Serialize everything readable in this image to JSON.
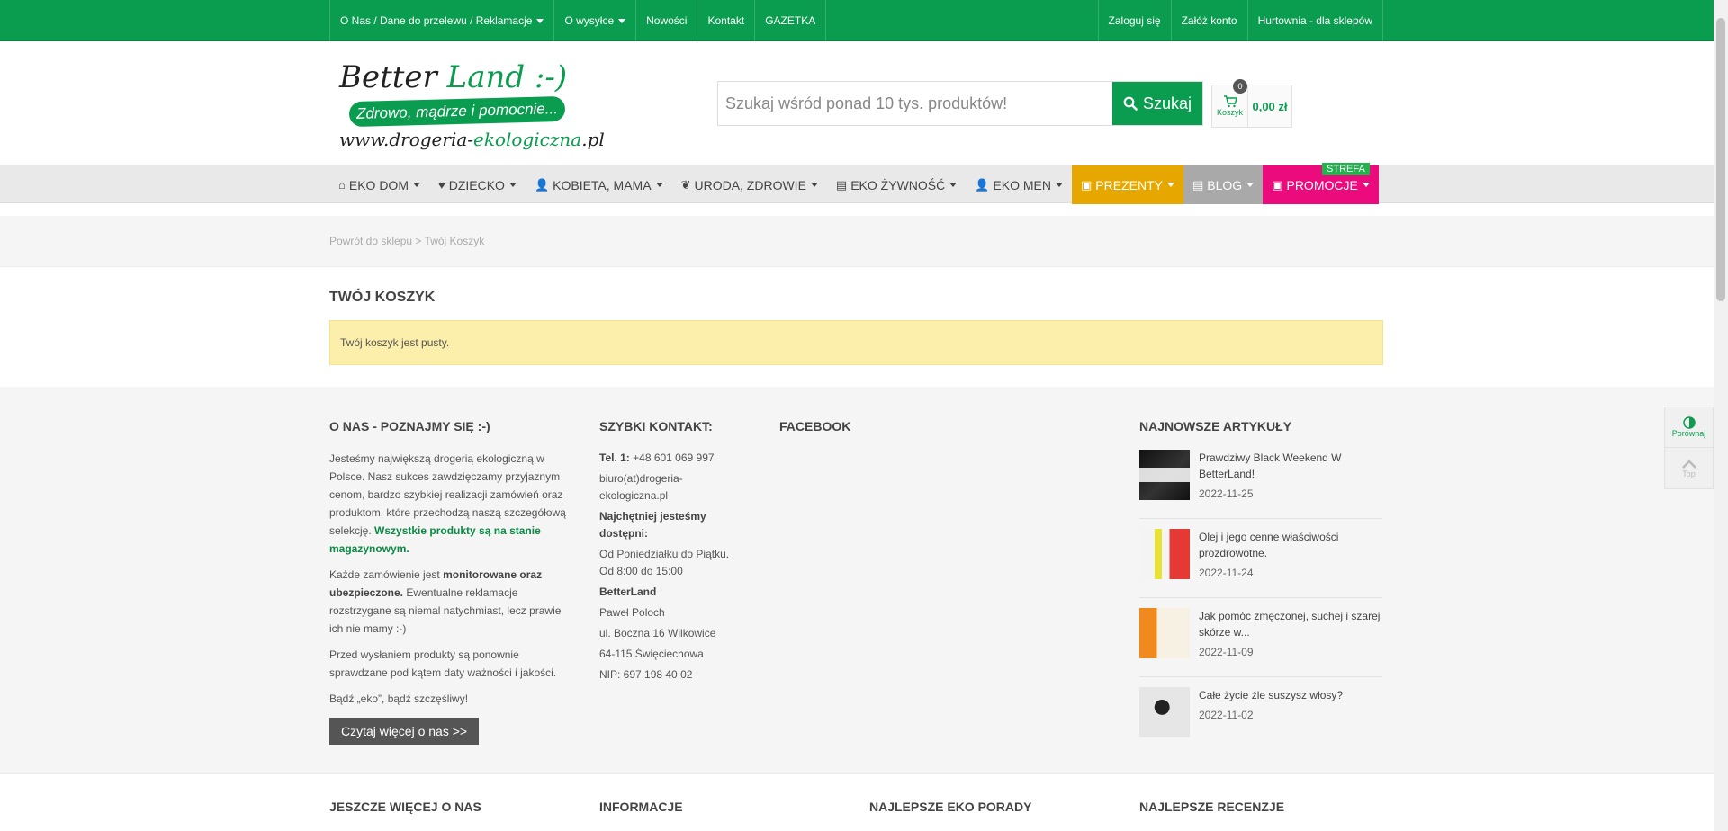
{
  "topbar": {
    "left": [
      {
        "label": "O Nas / Dane do przelewu / Reklamacje",
        "caret": true
      },
      {
        "label": "O wysyłce",
        "caret": true
      },
      {
        "label": "Nowości",
        "caret": false
      },
      {
        "label": "Kontakt",
        "caret": false
      },
      {
        "label": "GAZETKA",
        "caret": false
      }
    ],
    "right": [
      "Zaloguj się",
      "Załóż konto",
      "Hurtownia - dla sklepów"
    ]
  },
  "logo": {
    "line1_a": "Better ",
    "line1_b": "Land :-)",
    "slogan": "Zdrowo, mądrze i pomocnie...",
    "url_a": "www.drogeria-",
    "url_b": "ekologiczna",
    "url_c": ".pl"
  },
  "search": {
    "placeholder": "Szukaj wśród ponad 10 tys. produktów!",
    "button": "Szukaj"
  },
  "cart": {
    "count": "0",
    "label": "Koszyk",
    "total": "0,00 zł"
  },
  "nav": [
    {
      "label": "EKO DOM",
      "icon": "home-icon",
      "glyph": "⌂",
      "style": ""
    },
    {
      "label": "DZIECKO",
      "icon": "heart-icon",
      "glyph": "♥",
      "style": ""
    },
    {
      "label": "KOBIETA, MAMA",
      "icon": "user-icon",
      "glyph": "👤",
      "style": ""
    },
    {
      "label": "URODA, ZDROWIE",
      "icon": "leaf-icon",
      "glyph": "❦",
      "style": ""
    },
    {
      "label": "EKO ŻYWNOŚĆ",
      "icon": "shop-icon",
      "glyph": "▤",
      "style": ""
    },
    {
      "label": "EKO MEN",
      "icon": "man-icon",
      "glyph": "👤",
      "style": ""
    },
    {
      "label": "PREZENTY",
      "icon": "gift-icon",
      "glyph": "▣",
      "style": "gold"
    },
    {
      "label": "BLOG",
      "icon": "document-icon",
      "glyph": "▤",
      "style": "gray"
    },
    {
      "label": "PROMOCJE",
      "icon": "gift-icon",
      "glyph": "▣",
      "style": "pink",
      "badge": "STREFA"
    }
  ],
  "breadcrumb": {
    "back": "Powrót do sklepu",
    "sep": ">",
    "current": "Twój Koszyk"
  },
  "main": {
    "title": "TWÓJ KOSZYK",
    "alert": "Twój koszyk jest pusty."
  },
  "footer": {
    "about": {
      "heading": "O NAS - POZNAJMY SIĘ :-)",
      "p1": "Jesteśmy największą drogerią ekologiczną w Polsce. Nasz sukces zawdzięczamy przyjaznym cenom, bardzo szybkiej realizacji zamówień oraz produktom, które przechodzą naszą szczegółową selekcję. ",
      "p1_green": "Wszystkie produkty są na stanie magazynowym.",
      "p2_a": "Każde zamówienie jest ",
      "p2_b": "monitorowane oraz ubezpieczone.",
      "p2_c": " Ewentualne reklamacje rozstrzygane są niemal natychmiast, lecz prawie ich nie mamy :-)",
      "p3": "Przed wysłaniem produkty są ponownie sprawdzane pod kątem daty ważności i jakości.",
      "p4": "Bądź „eko”, bądź szczęśliwy!",
      "button": "Czytaj więcej o nas >>"
    },
    "contact": {
      "heading": "SZYBKI KONTAKT:",
      "tel_label": "Tel. 1:",
      "tel": " +48 601 069 997",
      "email": "biuro(at)drogeria-ekologiczna.pl",
      "hours_label": "Najchętniej jesteśmy dostępni:",
      "hours": "Od Poniedziałku do Piątku. Od 8:00 do 15:00",
      "company": "BetterLand",
      "person": "Paweł Poloch",
      "street": "ul. Boczna 16 Wilkowice",
      "city": "64-115 Święciechowa",
      "nip": "NIP: 697 198 40 02"
    },
    "facebook": {
      "heading": "FACEBOOK"
    },
    "articles": {
      "heading": "NAJNOWSZE ARTYKUŁY",
      "items": [
        {
          "title": "Prawdziwy Black Weekend W BetterLand!",
          "date": "2022-11-25"
        },
        {
          "title": "Olej i jego cenne właściwości prozdrowotne.",
          "date": "2022-11-24"
        },
        {
          "title": "Jak pomóc zmęczonej, suchej i szarej skórze w...",
          "date": "2022-11-09"
        },
        {
          "title": "Całe życie źle suszysz włosy?",
          "date": "2022-11-02"
        }
      ]
    }
  },
  "footer2": [
    "JESZCZE WIĘCEJ O NAS",
    "INFORMACJE",
    "NAJLEPSZE EKO PORADY",
    "NAJLEPSZE RECENZJE"
  ],
  "side": {
    "compare": "Porównaj",
    "top": "Top"
  },
  "colors": {
    "brand": "#0a9d4f",
    "gold": "#e6a800",
    "pink": "#ec0b7d",
    "alert": "#fcefab"
  }
}
